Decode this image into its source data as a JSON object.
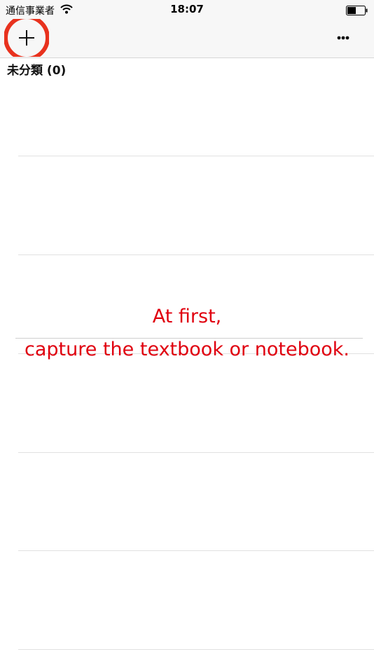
{
  "status_bar": {
    "carrier": "通信事業者",
    "time": "18:07",
    "wifi_icon": "wifi-icon",
    "battery_icon": "battery-icon"
  },
  "nav_bar": {
    "add_icon": "plus-icon",
    "more_icon": "ellipsis-icon",
    "highlight_color": "#e8321e"
  },
  "list": {
    "section_title": "未分類 (0)",
    "row_count": 6
  },
  "annotation": {
    "line1": "At first,",
    "line2": "capture the textbook or notebook.",
    "color": "#e0000f"
  }
}
